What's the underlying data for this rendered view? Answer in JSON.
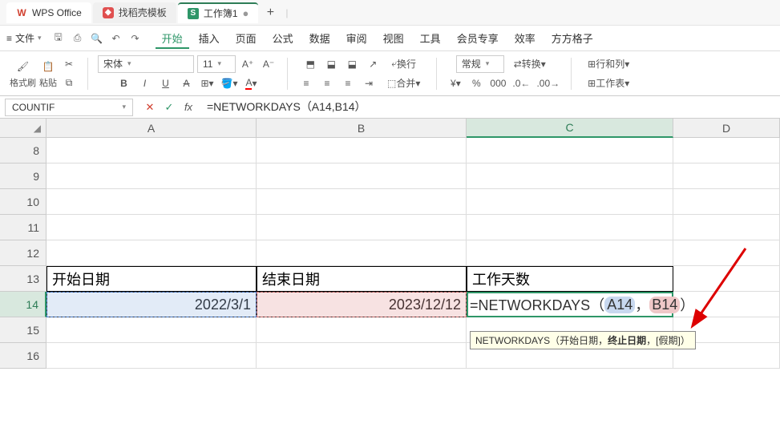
{
  "titlebar": {
    "app": "WPS Office",
    "tabs": [
      {
        "icon": "tpl",
        "label": "找稻壳模板"
      },
      {
        "icon": "sheet",
        "label": "工作簿1",
        "dirty": "●"
      }
    ],
    "new_tab": "+"
  },
  "menubar": {
    "file_label": "文件",
    "items": [
      "开始",
      "插入",
      "页面",
      "公式",
      "数据",
      "审阅",
      "视图",
      "工具",
      "会员专享",
      "效率",
      "方方格子"
    ],
    "active_index": 0
  },
  "toolbar": {
    "format_painter": "格式刷",
    "paste": "粘贴",
    "font_name": "宋体",
    "font_size": "11",
    "wrap_label": "换行",
    "merge_label": "合并",
    "number_format": "常规",
    "convert": "转换",
    "rowcol": "行和列",
    "worksheet": "工作表"
  },
  "formula_bar": {
    "name_box": "COUNTIF",
    "formula": "=NETWORKDAYS（A14,B14）"
  },
  "columns": [
    "A",
    "B",
    "C",
    "D"
  ],
  "rows": [
    "8",
    "9",
    "10",
    "11",
    "12",
    "13",
    "14",
    "15",
    "16"
  ],
  "cells": {
    "A13": "开始日期",
    "B13": "结束日期",
    "C13": "工作天数",
    "A14": "2022/3/1",
    "B14": "2023/12/12"
  },
  "editing": {
    "prefix": "=NETWORKDAYS（",
    "arg1": "A14",
    "sep": "，",
    "arg2": "B14",
    "suffix": "）"
  },
  "tooltip": {
    "fn": "NETWORKDAYS",
    "sig_prefix": "（开始日期，",
    "sig_current": "终止日期",
    "sig_suffix": "，[假期]）"
  }
}
